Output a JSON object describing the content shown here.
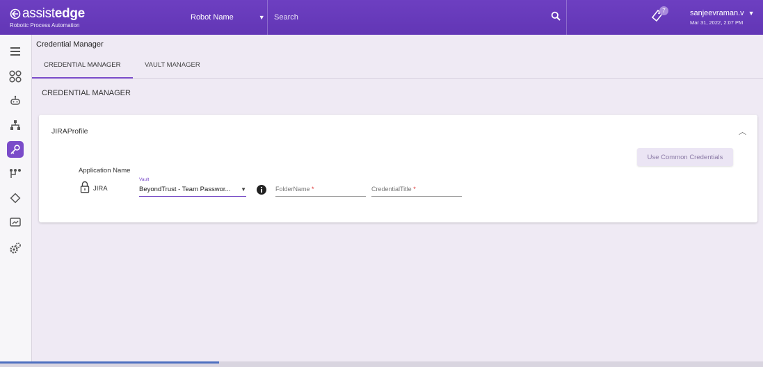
{
  "app": {
    "logo_thin": "assist",
    "logo_bold": "edge",
    "logo_sub": "Robotic Process Automation",
    "robot_select": "Robot Name",
    "search_placeholder": "Search",
    "notification_count": "7",
    "user_name": "sanjeevraman.v",
    "user_date": "Mar 31, 2022, 2:07 PM"
  },
  "sidebar": {
    "items": [
      {
        "icon": "menu-icon"
      },
      {
        "icon": "dashboard-icon"
      },
      {
        "icon": "robot-icon"
      },
      {
        "icon": "hierarchy-icon"
      },
      {
        "icon": "key-icon",
        "active": true
      },
      {
        "icon": "workflow-icon"
      },
      {
        "icon": "diamond-icon"
      },
      {
        "icon": "monitor-icon"
      },
      {
        "icon": "settings-icon"
      }
    ]
  },
  "page": {
    "title": "Credential Manager",
    "tabs": [
      {
        "label": "CREDENTIAL MANAGER",
        "active": true
      },
      {
        "label": "VAULT MANAGER",
        "active": false
      }
    ],
    "section_title": "CREDENTIAL MANAGER"
  },
  "profile": {
    "title": "JIRAProfile",
    "common_button": "Use Common Credentials",
    "app_header": "Application Name",
    "app_name": "JIRA",
    "vault_label": "Vault",
    "vault_value": "BeyondTrust - Team Passwor...",
    "folder_label": "FolderName",
    "credential_label": "CredentialTitle",
    "required_mark": "*"
  },
  "colors": {
    "brand": "#6d3fc1",
    "active_sidebar": "#7a4bc9",
    "background": "#efeaf4"
  }
}
